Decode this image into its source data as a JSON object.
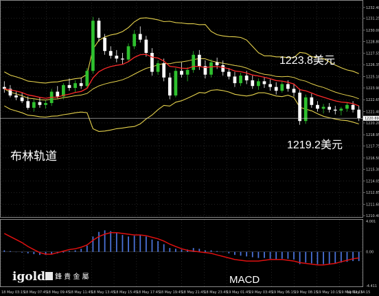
{
  "chart_data": [
    {
      "type": "candlestick",
      "chart_overlays": [
        "bollinger-bands",
        "moving-average"
      ],
      "colors": {
        "up": "#2ec02e",
        "down": "#ffffff",
        "bands": "#e8d44d",
        "ma": "#ff2a2a",
        "price_line": "#cfcfcf",
        "grid": "#5a5a5a"
      },
      "ylim": [
        1210.4,
        1232.9
      ],
      "y_ticks": [
        "1232.40",
        "1231.25",
        "1230.00",
        "1228.80",
        "1227.55",
        "1226.35",
        "1225.10",
        "1223.90",
        "1222.65",
        "1221.40",
        "1220.20",
        "1218.95",
        "1217.75",
        "1216.50",
        "1215.30",
        "1214.05",
        "1212.85",
        "1211.60",
        "1210.40"
      ],
      "x_ticks": [
        "18 May 03:15",
        "18 May 07:45",
        "18 May 09:45",
        "18 May 11:45",
        "18 May 13:45",
        "18 May 15:45",
        "18 May 17:45",
        "18 May 19:45",
        "18 May 21:45",
        "18 May 23:45",
        "19 May 01:45",
        "19 May 03:45",
        "19 May 06:15",
        "19 May 08:15",
        "19 May 10:15",
        "19 May 12:15",
        "19 May 14:15"
      ],
      "current_price": "1220.69",
      "ohlc": [
        [
          1224.0,
          1224.6,
          1223.4,
          1223.8
        ],
        [
          1223.8,
          1224.2,
          1222.9,
          1223.1
        ],
        [
          1223.1,
          1223.5,
          1222.6,
          1222.9
        ],
        [
          1222.9,
          1223.4,
          1222.3,
          1222.5
        ],
        [
          1222.5,
          1223.0,
          1221.6,
          1221.8
        ],
        [
          1221.8,
          1222.7,
          1221.4,
          1222.4
        ],
        [
          1222.4,
          1222.9,
          1221.8,
          1222.1
        ],
        [
          1222.1,
          1222.6,
          1221.7,
          1222.3
        ],
        [
          1222.3,
          1223.8,
          1222.0,
          1223.5
        ],
        [
          1223.5,
          1224.1,
          1222.8,
          1223.0
        ],
        [
          1223.0,
          1224.4,
          1222.7,
          1224.2
        ],
        [
          1224.2,
          1224.9,
          1223.6,
          1223.9
        ],
        [
          1223.9,
          1224.7,
          1223.4,
          1224.4
        ],
        [
          1224.4,
          1225.0,
          1223.8,
          1224.1
        ],
        [
          1224.1,
          1226.0,
          1223.9,
          1225.7
        ],
        [
          1225.7,
          1231.4,
          1225.4,
          1231.0
        ],
        [
          1231.0,
          1231.3,
          1228.8,
          1229.2
        ],
        [
          1229.2,
          1229.6,
          1227.4,
          1227.8
        ],
        [
          1227.8,
          1228.3,
          1227.0,
          1227.3
        ],
        [
          1227.3,
          1227.9,
          1226.6,
          1227.0
        ],
        [
          1227.0,
          1227.6,
          1226.4,
          1226.9
        ],
        [
          1226.9,
          1228.6,
          1226.7,
          1228.3
        ],
        [
          1228.3,
          1230.0,
          1228.0,
          1229.6
        ],
        [
          1229.6,
          1230.4,
          1228.7,
          1229.0
        ],
        [
          1229.0,
          1229.4,
          1227.2,
          1227.6
        ],
        [
          1227.6,
          1228.1,
          1225.2,
          1225.6
        ],
        [
          1225.6,
          1226.8,
          1225.3,
          1226.5
        ],
        [
          1226.5,
          1227.0,
          1224.6,
          1225.0
        ],
        [
          1225.0,
          1225.5,
          1222.7,
          1223.1
        ],
        [
          1223.1,
          1226.0,
          1222.9,
          1225.7
        ],
        [
          1225.7,
          1226.6,
          1225.0,
          1225.3
        ],
        [
          1225.3,
          1226.1,
          1224.6,
          1225.8
        ],
        [
          1225.8,
          1227.8,
          1225.5,
          1227.4
        ],
        [
          1227.4,
          1227.9,
          1225.8,
          1226.2
        ],
        [
          1226.2,
          1226.8,
          1224.9,
          1225.3
        ],
        [
          1225.3,
          1226.9,
          1225.0,
          1226.6
        ],
        [
          1226.6,
          1227.1,
          1225.9,
          1226.3
        ],
        [
          1226.3,
          1226.8,
          1225.2,
          1225.6
        ],
        [
          1225.6,
          1226.0,
          1224.8,
          1225.1
        ],
        [
          1225.1,
          1225.6,
          1224.0,
          1224.4
        ],
        [
          1224.4,
          1225.5,
          1224.1,
          1225.2
        ],
        [
          1225.2,
          1225.7,
          1224.3,
          1224.7
        ],
        [
          1224.7,
          1225.2,
          1223.8,
          1224.1
        ],
        [
          1224.1,
          1224.9,
          1223.7,
          1224.6
        ],
        [
          1224.6,
          1225.0,
          1223.9,
          1224.3
        ],
        [
          1224.3,
          1224.8,
          1223.6,
          1224.0
        ],
        [
          1224.0,
          1224.5,
          1223.2,
          1223.6
        ],
        [
          1223.6,
          1224.6,
          1223.4,
          1224.3
        ],
        [
          1224.3,
          1224.7,
          1223.5,
          1223.8
        ],
        [
          1223.8,
          1224.3,
          1223.0,
          1223.4
        ],
        [
          1223.4,
          1223.8,
          1220.0,
          1220.4
        ],
        [
          1220.4,
          1223.2,
          1220.1,
          1222.9
        ],
        [
          1222.9,
          1223.3,
          1221.8,
          1222.1
        ],
        [
          1222.1,
          1222.5,
          1221.4,
          1221.7
        ],
        [
          1221.7,
          1222.2,
          1221.2,
          1221.9
        ],
        [
          1221.9,
          1222.3,
          1221.3,
          1221.6
        ],
        [
          1221.6,
          1222.0,
          1221.1,
          1221.5
        ],
        [
          1221.5,
          1221.9,
          1221.0,
          1221.7
        ],
        [
          1221.7,
          1222.4,
          1221.4,
          1222.1
        ],
        [
          1222.1,
          1222.5,
          1221.3,
          1221.6
        ],
        [
          1221.6,
          1222.0,
          1220.4,
          1220.7
        ]
      ],
      "annotations": {
        "upper_value": "1223.8美元",
        "lower_value": "1219.2美元",
        "label": "布林轨道"
      }
    },
    {
      "type": "bar",
      "chart_overlays": [
        "signal-line"
      ],
      "ylim": [
        -4.411,
        4.001
      ],
      "y_ticks": [
        "4.001",
        "0.00",
        "-4.411"
      ],
      "colors": {
        "histogram": "#4a72d8",
        "signal": "#e01010"
      },
      "histogram": [
        0.2,
        0.1,
        0.0,
        -0.1,
        -0.2,
        -0.3,
        -0.4,
        -0.4,
        -0.3,
        -0.2,
        -0.1,
        0.1,
        0.2,
        0.4,
        0.8,
        2.0,
        2.6,
        2.8,
        2.7,
        2.5,
        2.2,
        2.0,
        2.1,
        2.2,
        2.0,
        1.6,
        1.4,
        1.0,
        0.5,
        0.4,
        0.3,
        0.3,
        0.5,
        0.4,
        0.2,
        0.2,
        0.1,
        0.0,
        -0.2,
        -0.4,
        -0.5,
        -0.6,
        -0.7,
        -0.8,
        -0.8,
        -0.9,
        -1.0,
        -0.9,
        -0.9,
        -1.0,
        -1.6,
        -1.4,
        -1.5,
        -1.6,
        -1.6,
        -1.6,
        -1.5,
        -1.4,
        -1.3,
        -1.2,
        -1.2
      ],
      "signal": [
        2.4,
        2.0,
        1.6,
        1.2,
        0.7,
        0.3,
        -0.1,
        -0.3,
        -0.3,
        -0.1,
        0.1,
        0.3,
        0.4,
        0.6,
        0.9,
        1.5,
        2.0,
        2.3,
        2.5,
        2.5,
        2.4,
        2.3,
        2.2,
        2.2,
        2.1,
        1.9,
        1.7,
        1.4,
        1.0,
        0.7,
        0.4,
        0.2,
        0.1,
        0.0,
        -0.1,
        -0.2,
        -0.4,
        -0.6,
        -0.8,
        -1.0,
        -1.1,
        -1.2,
        -1.2,
        -1.2,
        -1.1,
        -1.0,
        -1.0,
        -1.0,
        -1.1,
        -1.2,
        -1.4,
        -1.5,
        -1.6,
        -1.7,
        -1.7,
        -1.6,
        -1.5,
        -1.3,
        -1.1,
        -0.9,
        -0.8
      ],
      "label": "MACD"
    }
  ],
  "logo": {
    "brand": "igold",
    "chinese": "鋒 貴 金 屬"
  }
}
